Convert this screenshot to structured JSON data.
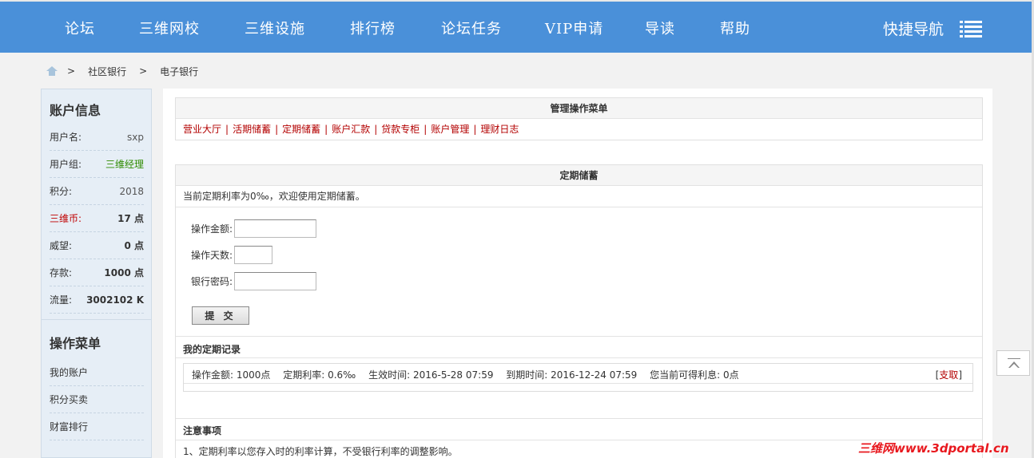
{
  "topnav": {
    "items": [
      "论坛",
      "三维网校",
      "三维设施",
      "排行榜",
      "论坛任务",
      "VIP申请",
      "导读",
      "帮助"
    ],
    "quick_nav": "快捷导航"
  },
  "breadcrumb": {
    "sep": ">",
    "items": [
      "社区银行",
      "电子银行"
    ]
  },
  "sidebar": {
    "account_title": "账户信息",
    "rows": [
      {
        "k": "用户名:",
        "v": "sxp"
      },
      {
        "k": "用户组:",
        "v": "三维经理"
      },
      {
        "k": "积分:",
        "v": "2018"
      },
      {
        "k": "三维币:",
        "v": "17 点"
      },
      {
        "k": "威望:",
        "v": "0 点"
      },
      {
        "k": "存款:",
        "v": "1000 点"
      },
      {
        "k": "流量:",
        "v": "3002102 K"
      }
    ],
    "menu_title": "操作菜单",
    "menu": [
      "我的账户",
      "积分买卖",
      "财富排行"
    ]
  },
  "manage": {
    "title": "管理操作菜单",
    "links": [
      "营业大厅",
      "活期储蓄",
      "定期储蓄",
      "账户汇款",
      "贷款专柜",
      "账户管理",
      "理财日志"
    ],
    "sep": "|"
  },
  "deposit": {
    "title": "定期储蓄",
    "intro": "当前定期利率为0‰，欢迎使用定期储蓄。",
    "amount_label": "操作金额:",
    "days_label": "操作天数:",
    "password_label": "银行密码:",
    "submit": "提 交",
    "records_title": "我的定期记录",
    "record": {
      "amount": "操作金额: 1000点",
      "rate": "定期利率: 0.6‰",
      "start": "生效时间: 2016-5-28 07:59",
      "end": "到期时间: 2016-12-24 07:59",
      "interest": "您当前可得利息: 0点",
      "withdraw": "支取"
    }
  },
  "notes": {
    "title": "注意事项",
    "line1": "1、定期利率以您存入时的利率计算，不受银行利率的调整影响。"
  },
  "watermark": "三维网www.3dportal.cn"
}
